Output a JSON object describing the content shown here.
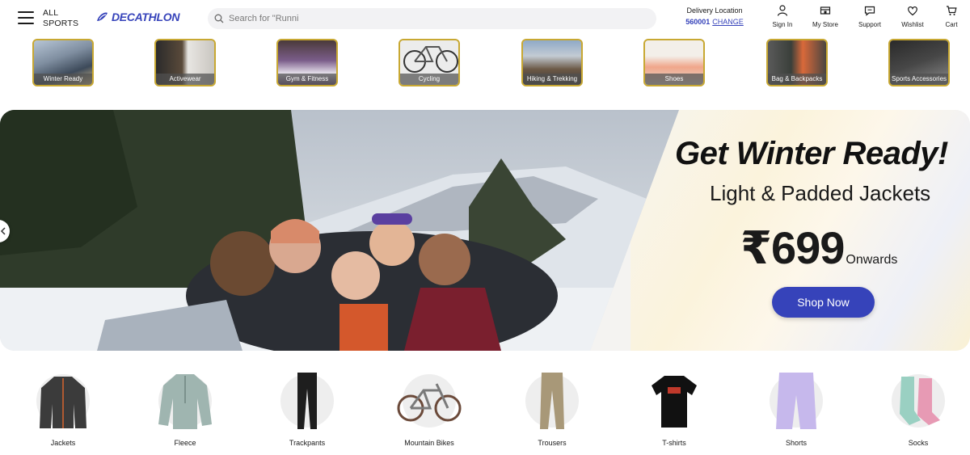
{
  "header": {
    "menu_label_line1": "ALL",
    "menu_label_line2": "SPORTS",
    "logo_text": "DECATHLON",
    "search_placeholder": "Search for \"Runni",
    "delivery_title": "Delivery Location",
    "delivery_pincode": "560001",
    "delivery_change": "CHANGE",
    "nav": [
      {
        "label": "Sign In",
        "icon": "user-icon"
      },
      {
        "label": "My Store",
        "icon": "store-icon"
      },
      {
        "label": "Support",
        "icon": "chat-icon"
      },
      {
        "label": "Wishlist",
        "icon": "heart-icon"
      },
      {
        "label": "Cart",
        "icon": "cart-icon"
      }
    ]
  },
  "categories": [
    {
      "label": "Winter Ready"
    },
    {
      "label": "Activewear"
    },
    {
      "label": "Gym & Fitness"
    },
    {
      "label": "Cycling"
    },
    {
      "label": "Hiking & Trekking"
    },
    {
      "label": "Shoes"
    },
    {
      "label": "Bag & Backpacks"
    },
    {
      "label": "Sports Accessories"
    }
  ],
  "banner": {
    "headline": "Get Winter Ready!",
    "subline": "Light & Padded Jackets",
    "price": "₹699",
    "price_suffix": "Onwards",
    "cta": "Shop Now"
  },
  "products": [
    {
      "label": "Jackets"
    },
    {
      "label": "Fleece"
    },
    {
      "label": "Trackpants"
    },
    {
      "label": "Mountain Bikes"
    },
    {
      "label": "Trousers"
    },
    {
      "label": "T-shirts"
    },
    {
      "label": "Shorts"
    },
    {
      "label": "Socks"
    }
  ],
  "colors": {
    "brand": "#3643ba",
    "tile_border": "#c8a832"
  }
}
